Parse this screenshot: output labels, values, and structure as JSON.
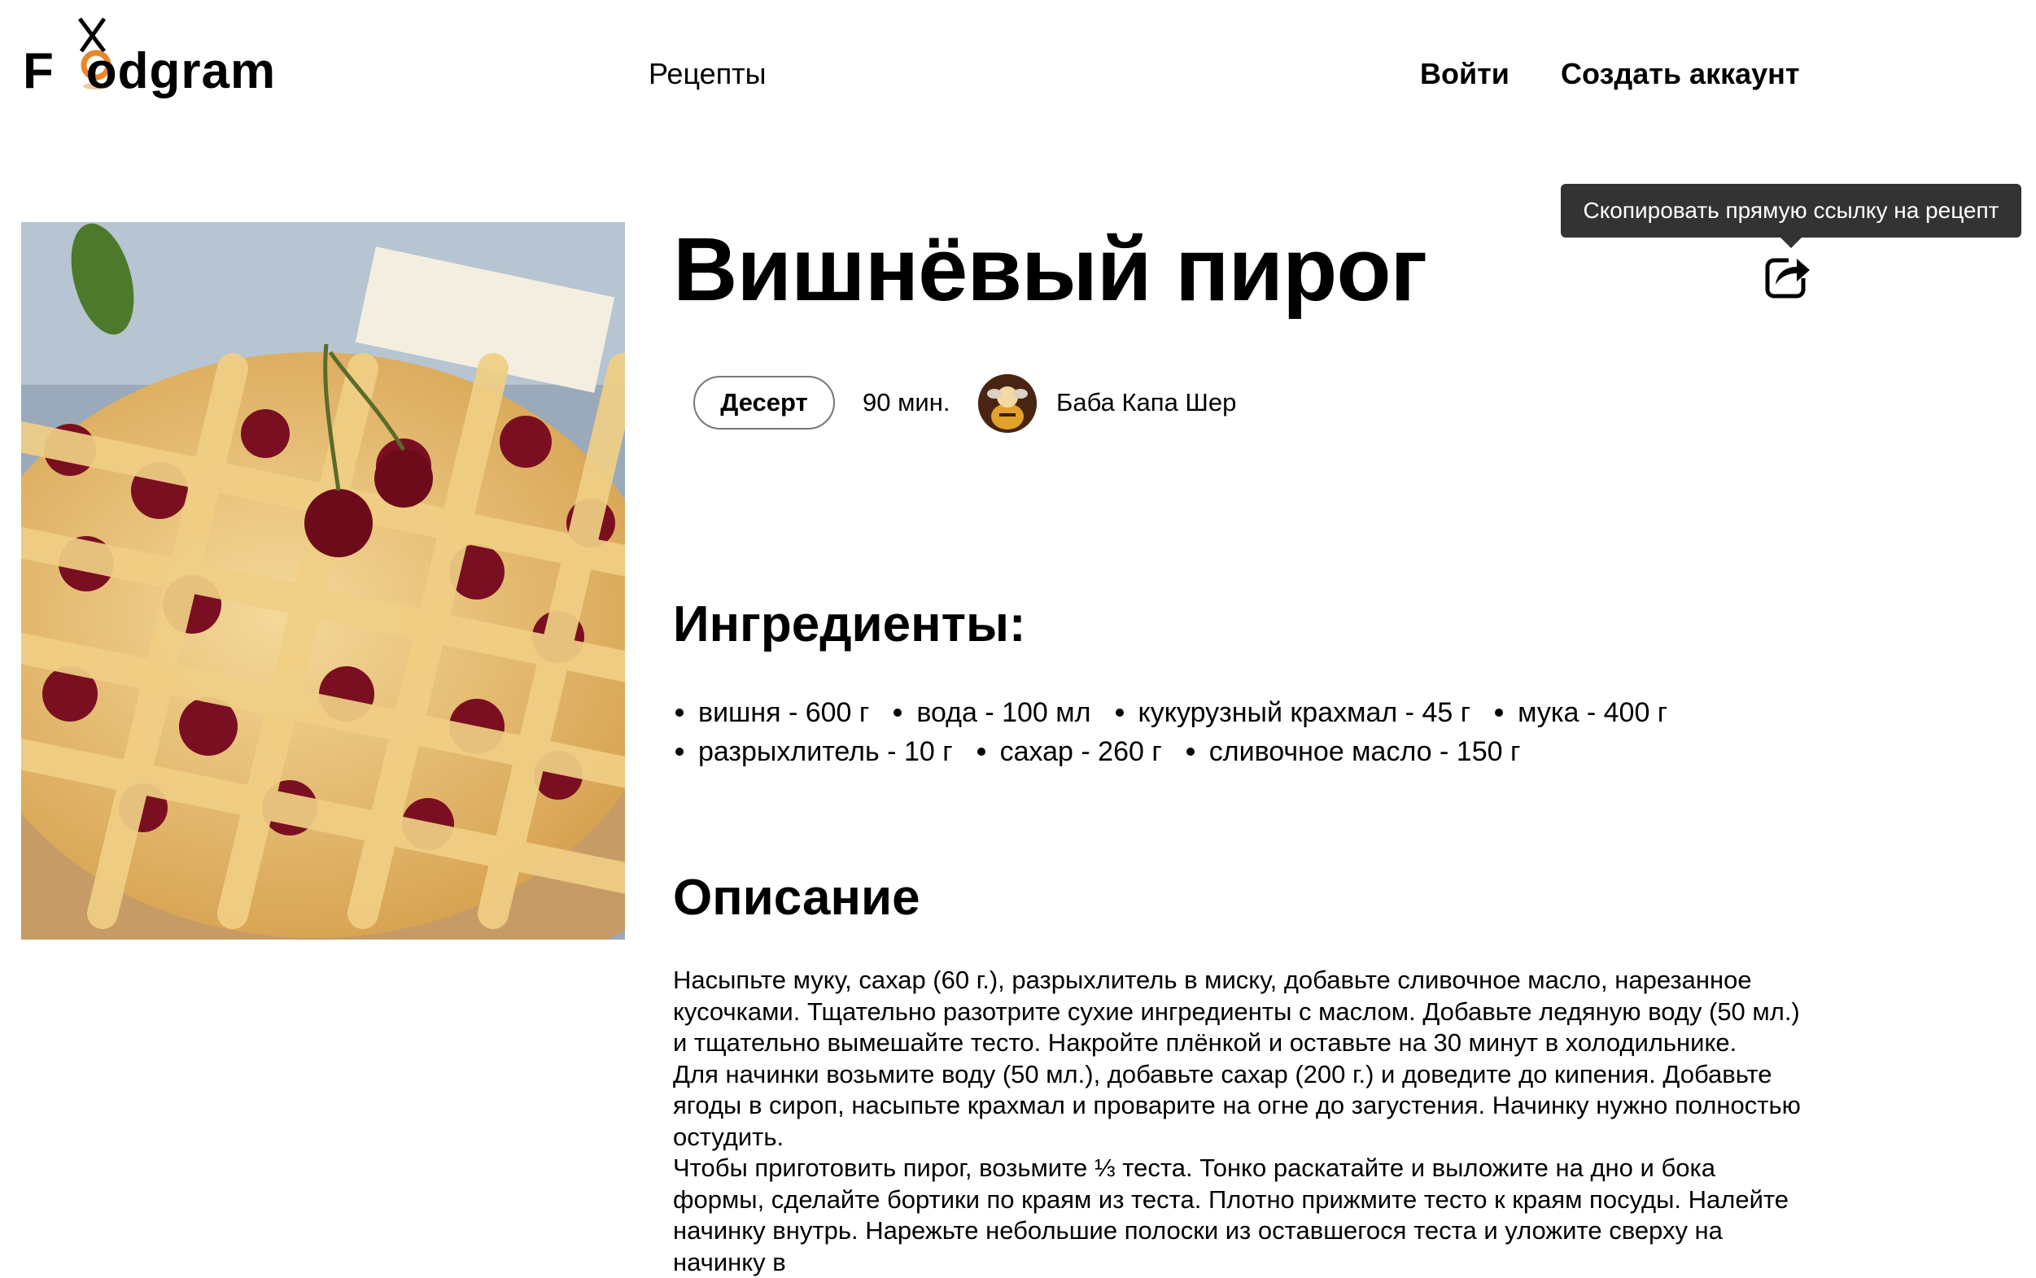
{
  "header": {
    "logo_text": "Foodgram",
    "nav": {
      "recipes": "Рецепты",
      "login": "Войти",
      "signup": "Создать аккаунт"
    }
  },
  "recipe": {
    "title": "Вишнёвый пирог",
    "tag": "Десерт",
    "time": "90 мин.",
    "author": "Баба Капа Шер",
    "share_tooltip": "Скопировать прямую ссылку на рецепт",
    "ingredients_title": "Ингредиенты:",
    "ingredients": [
      "вишня - 600 г",
      "вода - 100 мл",
      "кукурузный крахмал - 45 г",
      "мука - 400 г",
      "разрыхлитель - 10 г",
      "сахар - 260 г",
      "сливочное масло - 150 г"
    ],
    "description_title": "Описание",
    "description": [
      "Насыпьте муку, сахар (60 г.), разрыхлитель в миску, добавьте сливочное масло, нарезанное кусочками. Тщательно разотрите сухие ингредиенты с маслом. Добавьте ледяную воду (50 мл.) и тщательно вымешайте тесто. Накройте плёнкой и оставьте на 30 минут в холодильнике.",
      "Для начинки возьмите воду (50 мл.), добавьте сахар (200 г.) и доведите до кипения. Добавьте ягоды в сироп, насыпьте крахмал и проварите на огне до загустения. Начинку нужно полностью остудить.",
      "Чтобы приготовить пирог, возьмите ⅓ теста. Тонко раскатайте и выложите на дно и бока формы, сделайте бортики по краям из теста. Плотно прижмите тесто к краям посуды. Налейте начинку внутрь. Нарежьте небольшие полоски из оставшегося теста и уложите сверху на начинку в"
    ]
  },
  "colors": {
    "tooltip_bg": "#333333",
    "logo_accent": "#e8862a"
  },
  "icons": [
    "logo-fork-icon",
    "share-icon"
  ]
}
